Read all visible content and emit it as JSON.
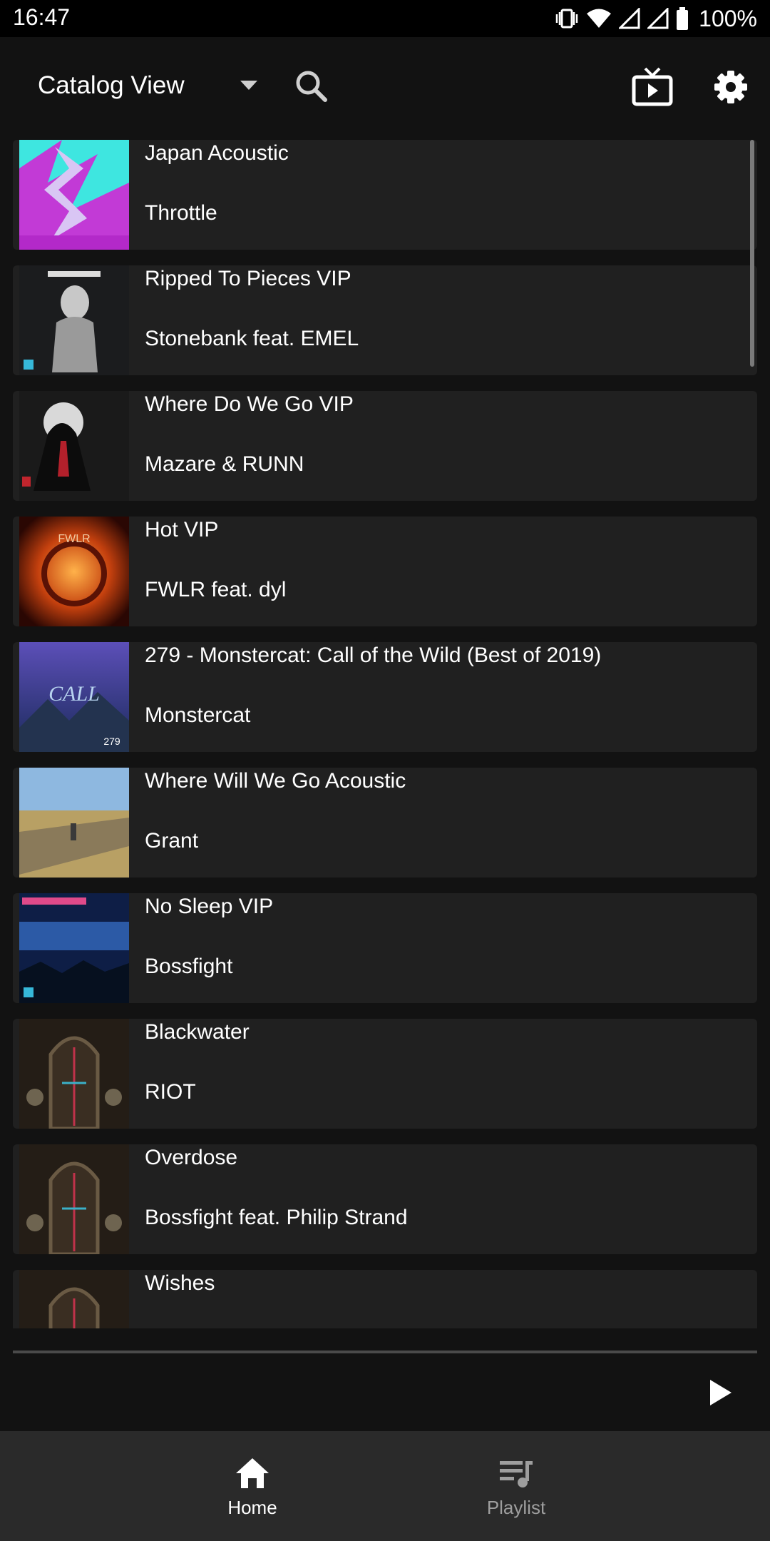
{
  "status_bar": {
    "time": "16:47",
    "battery": "100%"
  },
  "app_bar": {
    "view_label": "Catalog View"
  },
  "tracks": [
    {
      "title": "Japan Acoustic",
      "artist": "Throttle"
    },
    {
      "title": "Ripped To Pieces VIP",
      "artist": "Stonebank feat. EMEL"
    },
    {
      "title": "Where Do We Go VIP",
      "artist": "Mazare & RUNN"
    },
    {
      "title": "Hot VIP",
      "artist": "FWLR feat. dyl"
    },
    {
      "title": "279 - Monstercat: Call of the Wild (Best of 2019)",
      "artist": "Monstercat"
    },
    {
      "title": "Where Will We Go Acoustic",
      "artist": "Grant"
    },
    {
      "title": "No Sleep VIP",
      "artist": "Bossfight"
    },
    {
      "title": "Blackwater",
      "artist": "RIOT"
    },
    {
      "title": "Overdose",
      "artist": "Bossfight feat. Philip Strand"
    },
    {
      "title": "Wishes",
      "artist": ""
    }
  ],
  "bottom_nav": {
    "home": "Home",
    "playlist": "Playlist"
  },
  "colors": {
    "background": "#121212",
    "row": "#202020",
    "nav": "#2a2a2a",
    "inactive": "#9e9e9e"
  }
}
